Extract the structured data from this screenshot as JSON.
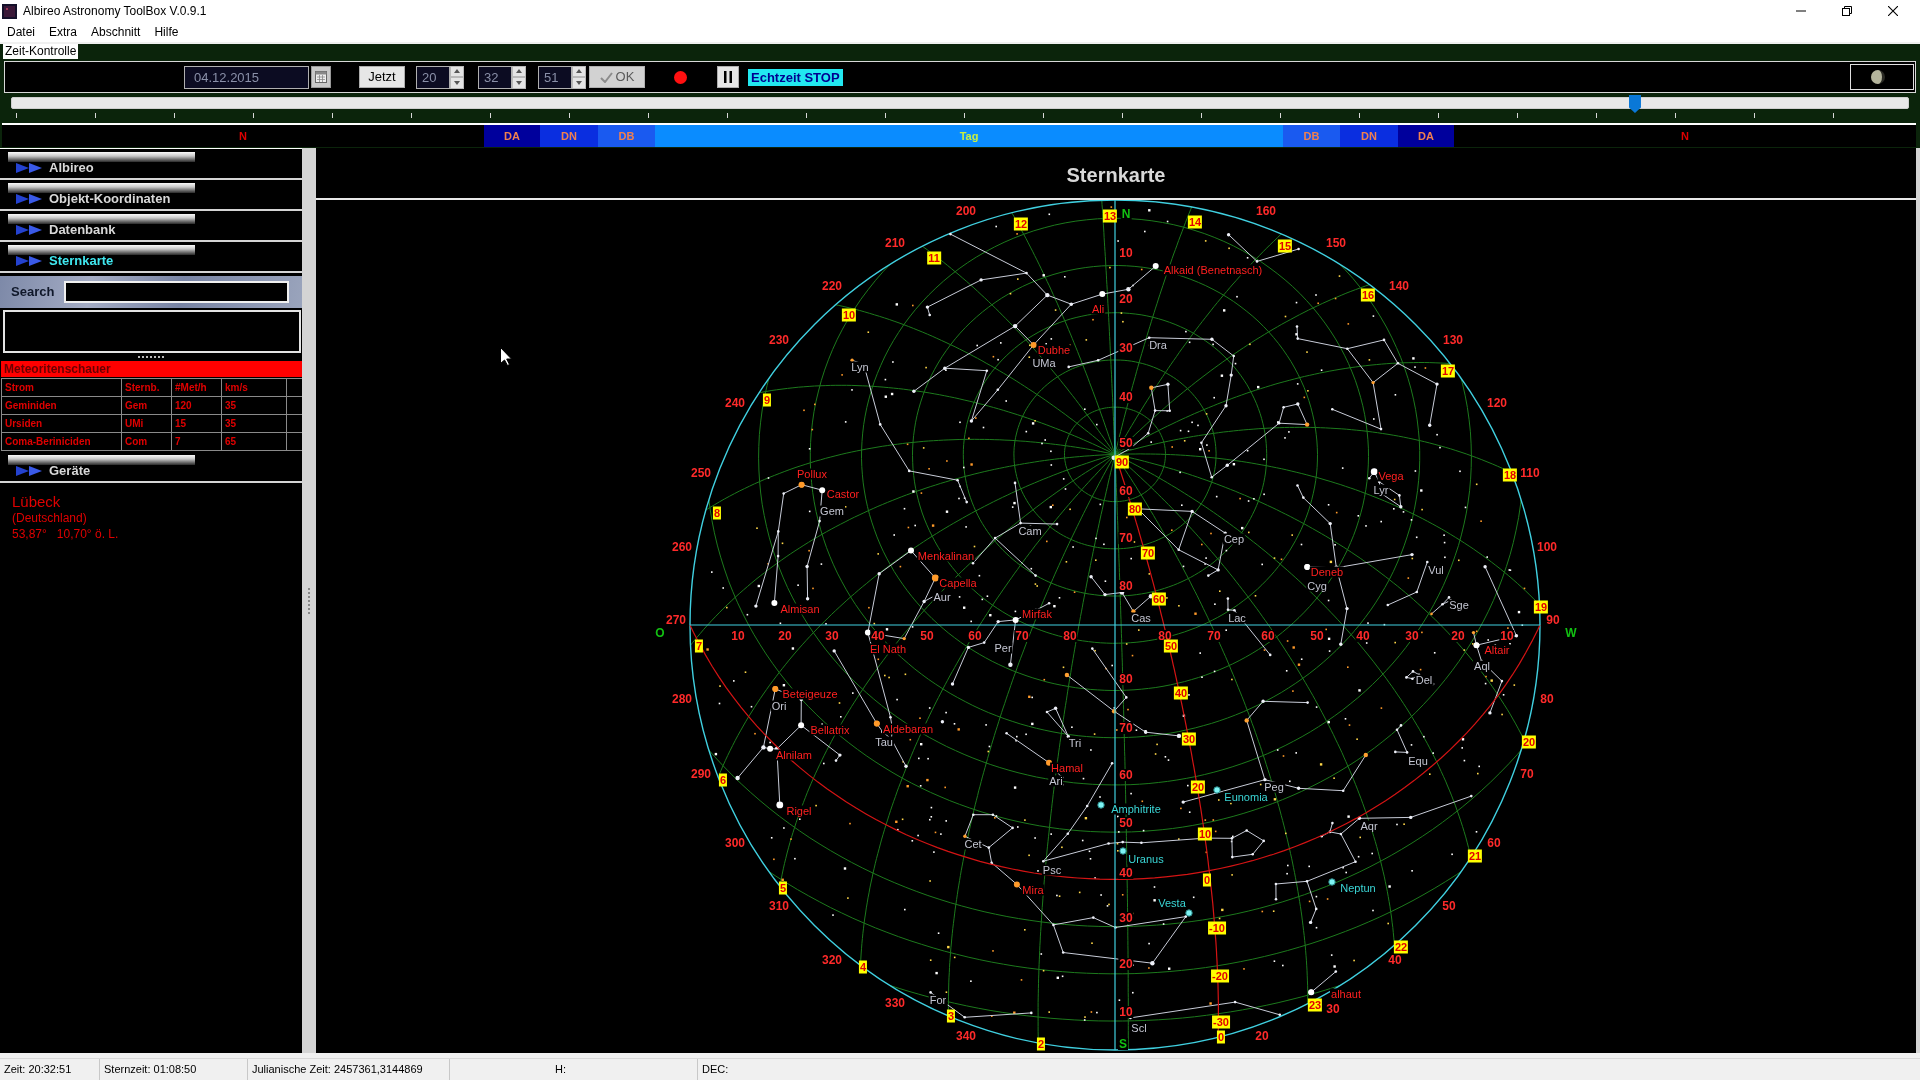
{
  "window": {
    "title": "Albireo Astronomy ToolBox V.0.9.1"
  },
  "menu": [
    {
      "label": "Datei"
    },
    {
      "label": "Extra"
    },
    {
      "label": "Abschnitt"
    },
    {
      "label": "Hilfe"
    }
  ],
  "time_control": {
    "title": "Zeit-Kontrolle",
    "date": "04.12.2015",
    "now_button": "Jetzt",
    "hour": "20",
    "minute": "32",
    "second": "51",
    "ok_button": {
      "label": "OK",
      "disabled": true
    },
    "realtime_status": "Echtzeit STOP",
    "timeline": {
      "level": 0.856
    },
    "day_phases": [
      {
        "label": "N",
        "kind": "night",
        "color": "#000000"
      },
      {
        "label": "DA",
        "kind": "twilight",
        "color": "#00009c"
      },
      {
        "label": "DN",
        "kind": "twilight",
        "color": "#0a2ee0"
      },
      {
        "label": "DB",
        "kind": "twilight",
        "color": "#1a5af0"
      },
      {
        "label": "Tag",
        "kind": "day",
        "color": "#0a8cff"
      },
      {
        "label": "DB",
        "kind": "twilight",
        "color": "#1a5af0"
      },
      {
        "label": "DN",
        "kind": "twilight",
        "color": "#0a2ee0"
      },
      {
        "label": "DA",
        "kind": "twilight",
        "color": "#00009c"
      },
      {
        "label": "N",
        "kind": "night",
        "color": "#000000"
      }
    ]
  },
  "sidebar": {
    "sections": [
      {
        "label": "Albireo",
        "selected": false
      },
      {
        "label": "Objekt-Koordinaten",
        "selected": false
      },
      {
        "label": "Datenbank",
        "selected": false
      },
      {
        "label": "Sternkarte",
        "selected": true
      }
    ],
    "search": {
      "label": "Search"
    },
    "meteor_showers": {
      "title": "Meteoritenschauer",
      "columns": [
        "Strom",
        "Sternb.",
        "#Met/h",
        "km/s"
      ],
      "rows": [
        [
          "Geminiden",
          "Gem",
          "120",
          "35"
        ],
        [
          "Ursiden",
          "UMi",
          "15",
          "35"
        ],
        [
          "Coma-Beriniciden",
          "Com",
          "7",
          "65"
        ]
      ]
    },
    "lower_sections": [
      {
        "label": "Geräte",
        "selected": false
      }
    ],
    "location": {
      "city": "Lübeck",
      "country": "(Deutschland)",
      "coordinates": "53,87°   10,70° ö. L."
    }
  },
  "star_chart": {
    "title": "Sternkarte",
    "cardinal_points": [
      "N",
      "O",
      "W",
      "S"
    ],
    "azimuth_labels": [
      "200",
      "210",
      "220",
      "230",
      "240",
      "250",
      "260",
      "270",
      "280",
      "290",
      "300",
      "310",
      "320",
      "330",
      "340",
      "20",
      "30",
      "40",
      "50",
      "60",
      "70",
      "80",
      "90",
      "100",
      "110",
      "120",
      "130",
      "140",
      "150",
      "160"
    ],
    "altitude_labels": [
      "10",
      "20",
      "30",
      "40",
      "50",
      "60",
      "70",
      "80",
      "80",
      "70",
      "60",
      "50",
      "40",
      "30",
      "20",
      "10",
      "10",
      "20",
      "30",
      "40",
      "50",
      "60",
      "70",
      "80",
      "80",
      "70",
      "60",
      "50",
      "40",
      "30",
      "20",
      "10"
    ],
    "hour_labels": [
      "13",
      "12",
      "11",
      "10",
      "9",
      "8",
      "7",
      "6",
      "5",
      "4",
      "3",
      "2",
      "0",
      "23",
      "22",
      "21",
      "20",
      "19",
      "18",
      "17",
      "16",
      "15",
      "14"
    ],
    "declination_labels": [
      "90",
      "80",
      "70",
      "60",
      "50",
      "40",
      "30",
      "20",
      "10",
      "0",
      "-10",
      "-20",
      "-30"
    ],
    "star_names": [
      "Alkaid (Benetnasch)",
      "Ali",
      "Dubhe",
      "Vega",
      "Pollux",
      "Castor",
      "Menkalinan",
      "Capella",
      "Almisan",
      "Deneb",
      "Mirfak",
      "El Nath",
      "Beteigeuze",
      "Bellatrix",
      "Aldebaran",
      "Alnilam",
      "Rigel",
      "Hamal",
      "Mira",
      "Altair",
      "alhaut"
    ],
    "constellations": [
      "UMa",
      "Dra",
      "Lyn",
      "Gem",
      "Cam",
      "Cep",
      "Lyr",
      "Cyg",
      "Vul",
      "Sge",
      "Aur",
      "Cas",
      "Lac",
      "Per",
      "Ori",
      "Tau",
      "Tri",
      "Ari",
      "Equ",
      "Peg",
      "Aqr",
      "Psc",
      "Cet",
      "Aql",
      "Del",
      "For",
      "Scl"
    ],
    "solar_system_objects": [
      "Amphitrite",
      "Eunomia",
      "Uranus",
      "Neptun",
      "Vesta"
    ]
  },
  "status_bar": [
    "Zeit: 20:32:51",
    "Sternzeit: 01:08:50",
    "Julianische Zeit: 2457361,3144869",
    "H:",
    "DEC:"
  ]
}
